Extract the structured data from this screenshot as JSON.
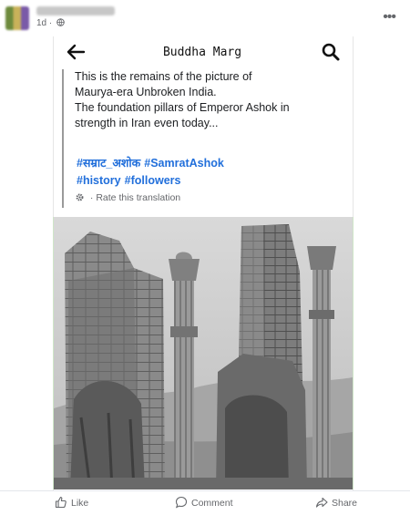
{
  "post": {
    "timestamp": "1d",
    "more_label": "•••"
  },
  "shared": {
    "app_title": "Buddha Marg",
    "lines": [
      "This is the remains of the picture of",
      "Maurya-era Unbroken India.",
      "The foundation pillars of Emperor Ashok in",
      "strength in Iran even today..."
    ],
    "hashtags": [
      "#सम्राट_अशोक",
      "#SamratAshok",
      "#history",
      "#followers"
    ],
    "translate_label": "Rate this translation",
    "translate_dot": "·"
  },
  "actions": {
    "like": "Like",
    "comment": "Comment",
    "share": "Share"
  },
  "colors": {
    "hashtag": "#216fdb",
    "secondary_text": "#65676b"
  }
}
